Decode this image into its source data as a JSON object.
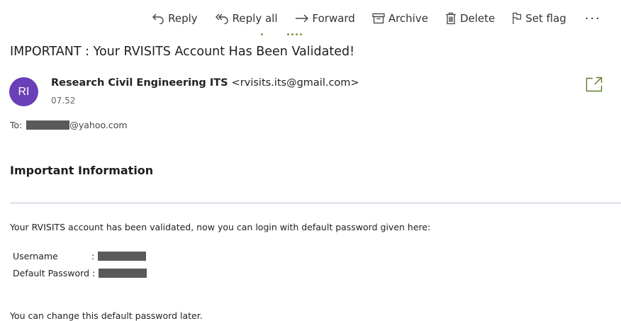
{
  "toolbar": {
    "reply": "Reply",
    "reply_all": "Reply all",
    "forward": "Forward",
    "archive": "Archive",
    "delete": "Delete",
    "set_flag": "Set flag",
    "more": "···"
  },
  "message": {
    "subject": "IMPORTANT : Your RVISITS Account Has Been Validated!",
    "avatar_initials": "RI",
    "avatar_color": "#6a40b8",
    "sender_name": "Research Civil Engineering ITS",
    "sender_email": "<rvisits.its@gmail.com>",
    "time": "07.52",
    "to_label": "To:",
    "to_domain": "@yahoo.com"
  },
  "body": {
    "heading": "Important Information",
    "intro": "Your RVISITS account has been validated, now you can login with default password given here:",
    "username_label": "Username",
    "password_label": "Default Password",
    "separator": ":",
    "footer": "You can change this default password later."
  },
  "colors": {
    "accent_dots": "#7c9a48",
    "popout_icon": "#5d7d2d",
    "divider": "#b8c6d4"
  }
}
